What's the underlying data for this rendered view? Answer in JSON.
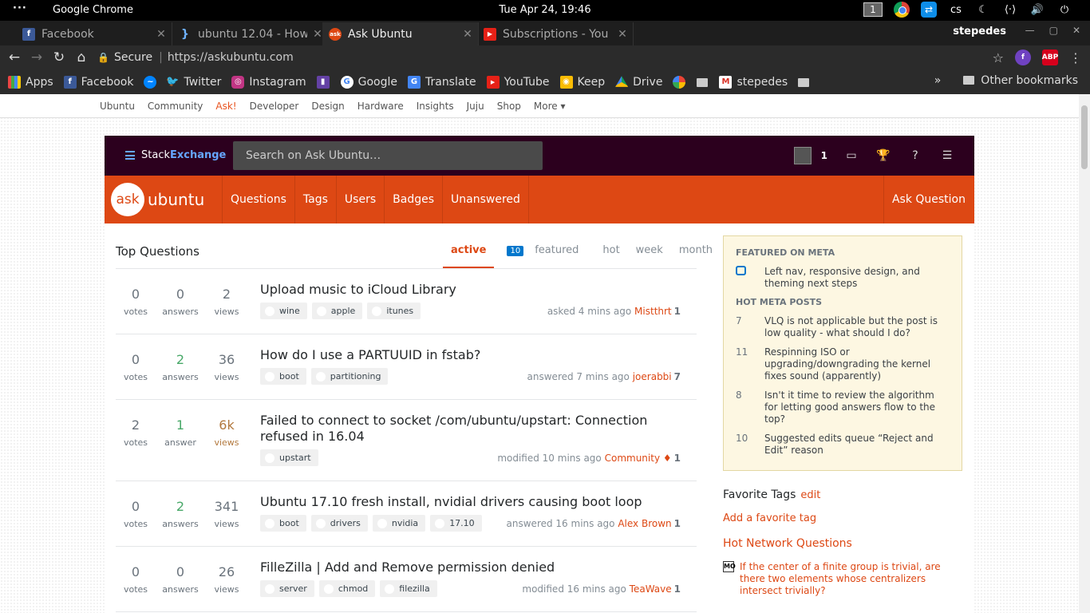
{
  "system": {
    "app_name": "Google Chrome",
    "clock": "Tue Apr 24, 19:46",
    "workspace": "1",
    "keyboard": "cs"
  },
  "tabs": [
    {
      "title": "Facebook",
      "icon": "facebook-icon",
      "color": "#3b5998"
    },
    {
      "title": "ubuntu 12.04 - How",
      "icon": "code-icon",
      "color": "#1e1e1e"
    },
    {
      "title": "Ask Ubuntu",
      "icon": "askubuntu-icon",
      "color": "#dd4814"
    },
    {
      "title": "Subscriptions - You",
      "icon": "youtube-icon",
      "color": "#e62117"
    }
  ],
  "profile_name": "stepedes",
  "omnibox": {
    "secure_label": "Secure",
    "url": "https://askubuntu.com"
  },
  "bookmarks": [
    {
      "label": "Apps",
      "icon": "apps-grid-icon"
    },
    {
      "label": "Facebook",
      "icon": "facebook-icon"
    },
    {
      "label": "",
      "icon": "messenger-icon"
    },
    {
      "label": "Twitter",
      "icon": "twitter-icon"
    },
    {
      "label": "Instagram",
      "icon": "instagram-icon"
    },
    {
      "label": "",
      "icon": "twitch-icon"
    },
    {
      "label": "Google",
      "icon": "google-icon"
    },
    {
      "label": "Translate",
      "icon": "translate-icon"
    },
    {
      "label": "YouTube",
      "icon": "youtube-icon"
    },
    {
      "label": "Keep",
      "icon": "keep-icon"
    },
    {
      "label": "Drive",
      "icon": "drive-icon"
    },
    {
      "label": "",
      "icon": "photos-icon"
    },
    {
      "label": "",
      "icon": "folder-icon"
    },
    {
      "label": "stepedes",
      "icon": "gmail-icon"
    },
    {
      "label": "",
      "icon": "folder-icon"
    }
  ],
  "bookmarks_more": "»",
  "other_bookmarks": "Other bookmarks",
  "ubuntu_nav": [
    "Ubuntu",
    "Community",
    "Ask!",
    "Developer",
    "Design",
    "Hardware",
    "Insights",
    "Juju",
    "Shop",
    "More ▾"
  ],
  "se_bar": {
    "logo_plain": "Stack",
    "logo_bold": "Exchange",
    "search_placeholder": "Search on Ask Ubuntu…",
    "reputation": "1"
  },
  "site_header": {
    "bubble": "ask",
    "wordmark": "ubuntu",
    "nav": [
      "Questions",
      "Tags",
      "Users",
      "Badges",
      "Unanswered"
    ],
    "ask_button": "Ask Question"
  },
  "questions_header": "Top Questions",
  "filters": {
    "badge": "10",
    "items": [
      "active",
      "featured",
      "hot",
      "week",
      "month"
    ]
  },
  "questions": [
    {
      "votes": "0",
      "votes_label": "votes",
      "answers": "0",
      "answers_label": "answers",
      "views": "2",
      "views_label": "views",
      "title": "Upload music to iCloud Library",
      "tags": [
        "wine",
        "apple",
        "itunes"
      ],
      "action": "asked 4 mins ago",
      "user": "Mistthrt",
      "rep": "1"
    },
    {
      "votes": "0",
      "votes_label": "votes",
      "answers": "2",
      "answers_label": "answers",
      "views": "36",
      "views_label": "views",
      "title": "How do I use a PARTUUID in fstab?",
      "tags": [
        "boot",
        "partitioning"
      ],
      "action": "answered 7 mins ago",
      "user": "joerabbi",
      "rep": "7"
    },
    {
      "votes": "2",
      "votes_label": "votes",
      "answers": "1",
      "answers_label": "answer",
      "views": "6k",
      "views_label": "views",
      "title": "Failed to connect to socket /com/ubuntu/upstart: Connection refused in 16.04",
      "tags": [
        "upstart"
      ],
      "action": "modified 10 mins ago",
      "user": "Community",
      "mod": "♦",
      "rep": "1"
    },
    {
      "votes": "0",
      "votes_label": "votes",
      "answers": "2",
      "answers_label": "answers",
      "views": "341",
      "views_label": "views",
      "title": "Ubuntu 17.10 fresh install, nvidial drivers causing boot loop",
      "tags": [
        "boot",
        "drivers",
        "nvidia",
        "17.10"
      ],
      "action": "answered 16 mins ago",
      "user": "Alex Brown",
      "rep": "1"
    },
    {
      "votes": "0",
      "votes_label": "votes",
      "answers": "0",
      "answers_label": "answers",
      "views": "26",
      "views_label": "views",
      "title": "FilleZilla | Add and Remove permission denied",
      "tags": [
        "server",
        "chmod",
        "filezilla"
      ],
      "action": "modified 16 mins ago",
      "user": "TeaWave",
      "rep": "1"
    }
  ],
  "sidebar": {
    "featured_heading": "FEATURED ON META",
    "featured_items": [
      "Left nav, responsive design, and theming next steps"
    ],
    "hot_heading": "HOT META POSTS",
    "hot_items": [
      {
        "num": "7",
        "text": "VLQ is not applicable but the post is low quality - what should I do?"
      },
      {
        "num": "11",
        "text": "Respinning ISO or upgrading/downgrading the kernel fixes sound (apparently)"
      },
      {
        "num": "8",
        "text": "Isn't it time to review the algorithm for letting good answers flow to the top?"
      },
      {
        "num": "10",
        "text": "Suggested edits queue “Reject and Edit” reason"
      }
    ],
    "fav_tags": "Favorite Tags",
    "fav_edit": "edit",
    "add_fav": "Add a favorite tag",
    "hnq_heading": "Hot Network Questions",
    "hnq_items": [
      {
        "site": "MO",
        "text": "If the center of a finite group is trivial, are there two elements whose centralizers intersect trivially?"
      }
    ]
  }
}
